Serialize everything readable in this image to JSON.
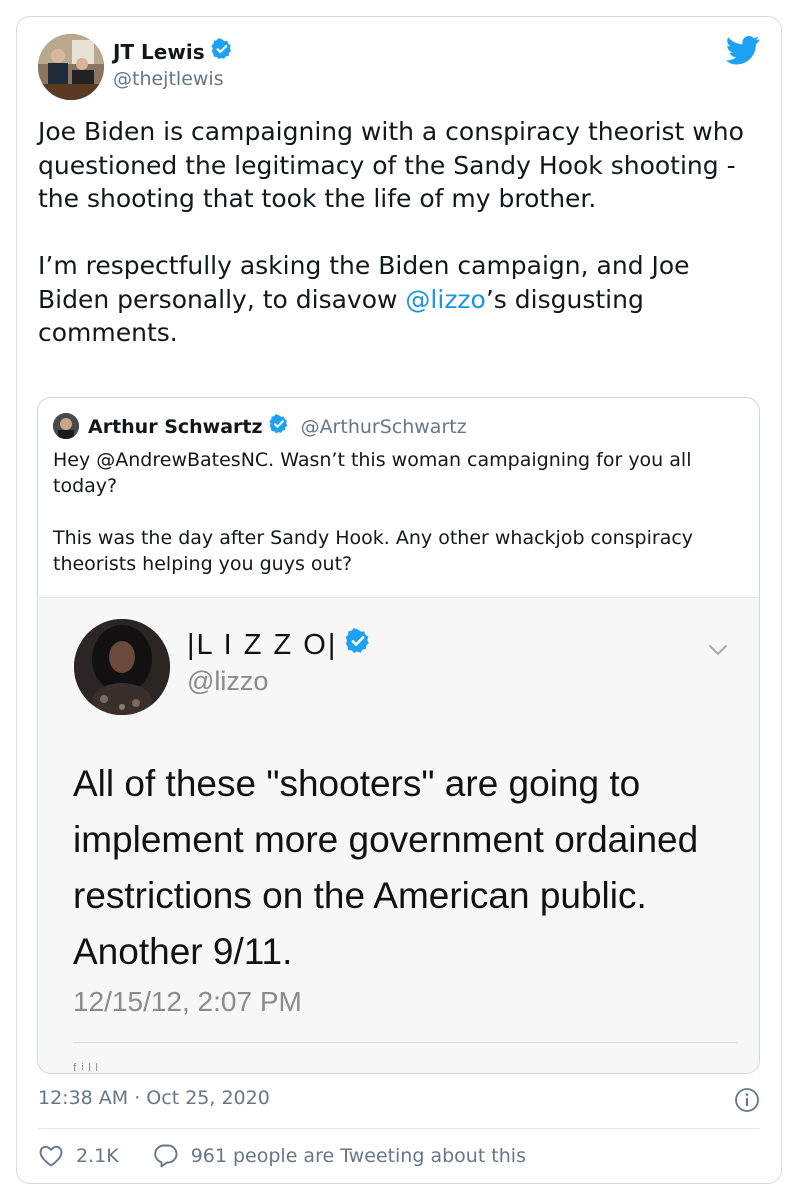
{
  "tweet": {
    "author_name": "JT Lewis",
    "author_handle": "@thejtlewis",
    "text_p1": "Joe Biden is campaigning with a conspiracy theorist who questioned the legitimacy of the Sandy Hook shooting - the shooting that took the life of my brother.",
    "text_p2_before": "I’m respectfully asking the Biden campaign, and Joe Biden personally, to disavow ",
    "text_p2_mention": "@lizzo",
    "text_p2_after": "’s disgusting comments.",
    "timestamp": "12:38 AM · Oct 25, 2020",
    "likes": "2.1K",
    "tweeting_text": "961 people are Tweeting about this"
  },
  "quoted": {
    "author_name": "Arthur Schwartz",
    "author_handle": "@ArthurSchwartz",
    "text_p1": "Hey @AndrewBatesNC. Wasn’t this woman campaigning for you all today?",
    "text_p2": "This was the day after Sandy Hook. Any other whackjob conspiracy theorists helping you guys out?"
  },
  "screenshot": {
    "author_name": "|L I Z Z O|",
    "author_handle": "@lizzo",
    "body": "All of these \"shooters\" are going to implement more government ordained restrictions on the American public. Another 9/11.",
    "time": "12/15/12, 2:07 PM"
  },
  "colors": {
    "accent": "#1da1f2",
    "mention": "#1b95e0",
    "verified": "#1da1f2",
    "secondary_text": "#657786"
  }
}
